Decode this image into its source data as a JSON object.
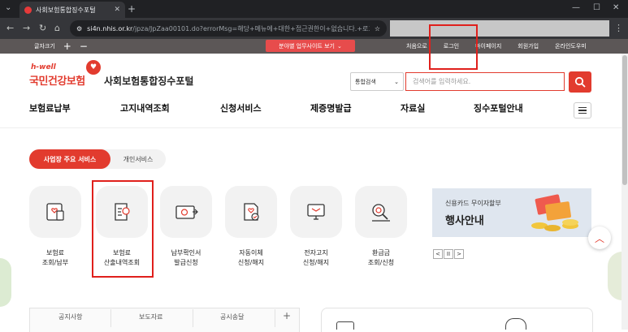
{
  "browser": {
    "tab_title": "사회보험통합징수포털",
    "url_host": "si4n.nhis.or.kr",
    "url_path": "/jpza/JpZaa00101.do?errorMsg=해당+메뉴에+대한+접근권한이+없습니다.+로그..."
  },
  "utility": {
    "font_size_label": "글자크기",
    "plus": "+",
    "minus": "−",
    "banner_label": "분야별 업무사이트 보기",
    "links": [
      "처음으로",
      "로그인",
      "마이페이지",
      "회원가입",
      "온라인도우미"
    ]
  },
  "header": {
    "logo_hwell": "h-well",
    "logo_main": "국민건강보험",
    "logo_sub": "사회보험통합징수포털",
    "search_scope": "통합검색",
    "search_placeholder": "검색어를 입력하세요."
  },
  "gnb": [
    "보험료납부",
    "고지내역조회",
    "신청서비스",
    "제증명발급",
    "자료실",
    "징수포털안내"
  ],
  "service_tabs": {
    "active": "사업장 주요 서비스",
    "inactive": "개인서비스"
  },
  "services": [
    {
      "label": "보험료\n조회/납부",
      "icon": "document-heart-icon"
    },
    {
      "label": "보험료\n산출내역조회",
      "icon": "calculator-list-icon"
    },
    {
      "label": "납부확인서\n발급신청",
      "icon": "certificate-icon"
    },
    {
      "label": "자동이체\n신청/해지",
      "icon": "auto-transfer-icon"
    },
    {
      "label": "전자고지\n신청/해지",
      "icon": "e-notice-icon"
    },
    {
      "label": "환급금\n조회/신청",
      "icon": "refund-search-icon"
    }
  ],
  "banner": {
    "subtitle": "신용카드 무이자할부",
    "title": "행사안내",
    "prev": "<",
    "pause": "II",
    "next": ">"
  },
  "notice_tabs": [
    "공지사항",
    "보도자료",
    "공시송달"
  ],
  "colors": {
    "accent": "#e23b2e",
    "util_bar": "#5c5757"
  }
}
